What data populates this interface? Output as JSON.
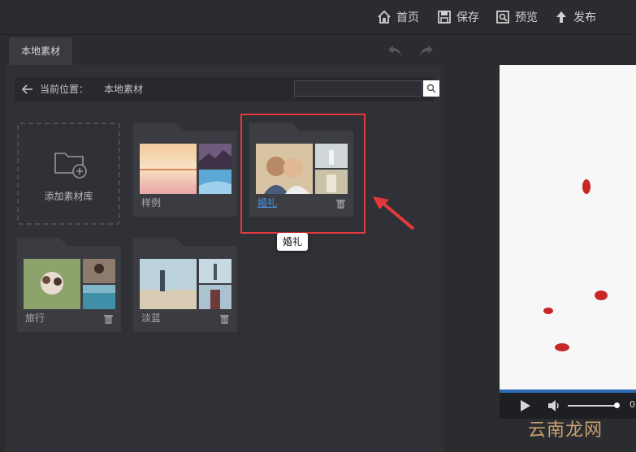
{
  "topbar": {
    "home": "首页",
    "save": "保存",
    "preview": "预览",
    "publish": "发布"
  },
  "panel": {
    "tab": "本地素材",
    "path_label": "当前位置：",
    "path_value": "本地素材",
    "search_placeholder": ""
  },
  "library": {
    "add_label": "添加素材库",
    "folders": [
      {
        "name": "样例"
      },
      {
        "name": "婚礼"
      },
      {
        "name": "旅行"
      },
      {
        "name": "淡蓝"
      }
    ]
  },
  "tooltip": "婚礼",
  "player": {
    "time": "0"
  },
  "watermark": "云南龙网",
  "colors": {
    "accent_blue": "#2d6ab5",
    "highlight_red": "#e0393e",
    "petal_red": "#d12a2a"
  }
}
